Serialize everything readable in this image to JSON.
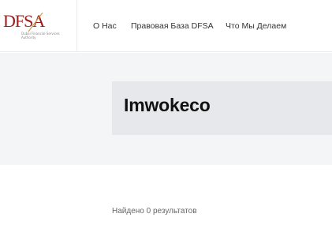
{
  "logo": {
    "mark": "DFSA",
    "subtitle": "Dubai Financial Services Authority"
  },
  "nav": {
    "items": [
      {
        "label": "О Нас"
      },
      {
        "label": "Правовая База DFSA"
      },
      {
        "label": "Что Мы Делаем"
      }
    ]
  },
  "page": {
    "title": "Imwokeco"
  },
  "search": {
    "results_text": "Найдено 0 результатов"
  },
  "colors": {
    "brand_red": "#9b1b1b",
    "hero_bg": "#f4f5f7",
    "title_box_bg": "#e6e8ec"
  }
}
